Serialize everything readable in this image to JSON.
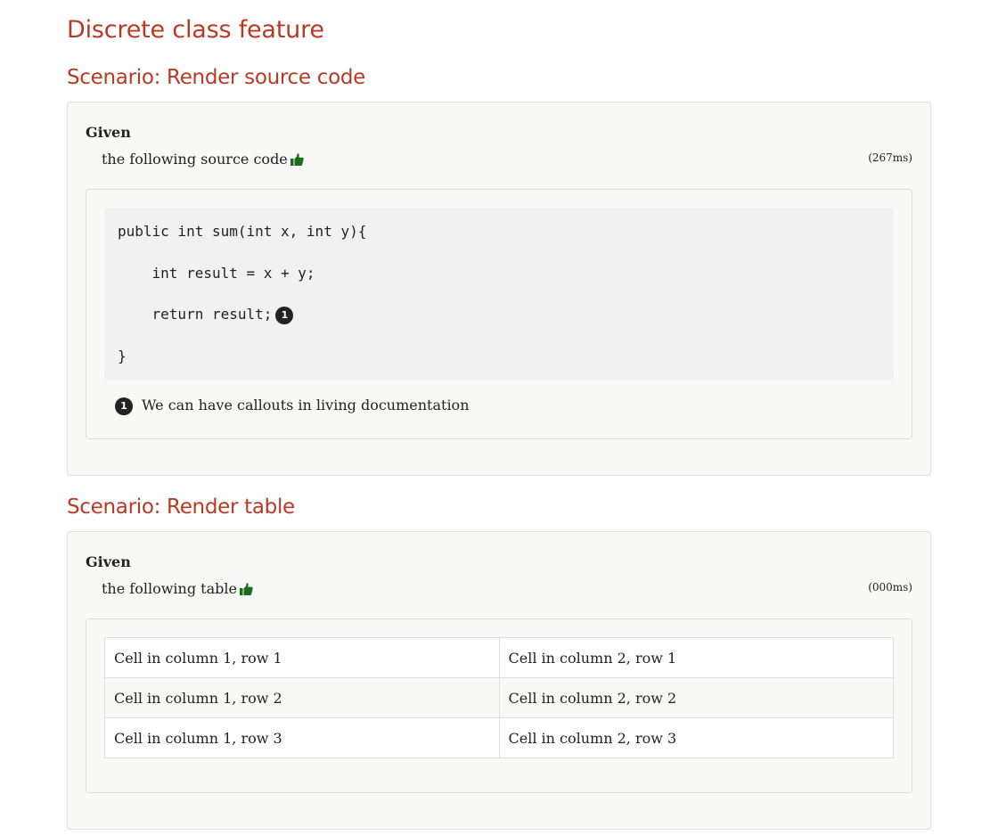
{
  "feature": {
    "title": "Discrete class feature"
  },
  "scenarios": [
    {
      "title": "Scenario: Render source code",
      "step": {
        "keyword": "Given",
        "text": "the following source code",
        "status_icon": "thumbs-up-icon",
        "duration": "(267ms)"
      },
      "code": {
        "lines": [
          "public int sum(int x, int y){",
          "    int result = x + y;",
          "    return result;",
          "}"
        ],
        "callout_number": "1"
      },
      "callout": {
        "number": "1",
        "text": "We can have callouts in living documentation"
      }
    },
    {
      "title": "Scenario: Render table",
      "step": {
        "keyword": "Given",
        "text": "the following table",
        "status_icon": "thumbs-up-icon",
        "duration": "(000ms)"
      },
      "table": {
        "rows": [
          [
            "Cell in column 1, row 1",
            "Cell in column 2, row 1"
          ],
          [
            "Cell in column 1, row 2",
            "Cell in column 2, row 2"
          ],
          [
            "Cell in column 1, row 3",
            "Cell in column 2, row 3"
          ]
        ]
      }
    }
  ],
  "colors": {
    "heading": "#ba3925",
    "passed_icon": "#1a6b1a",
    "panel_background": "#f8f8f7",
    "code_background": "#f1f1f1"
  }
}
